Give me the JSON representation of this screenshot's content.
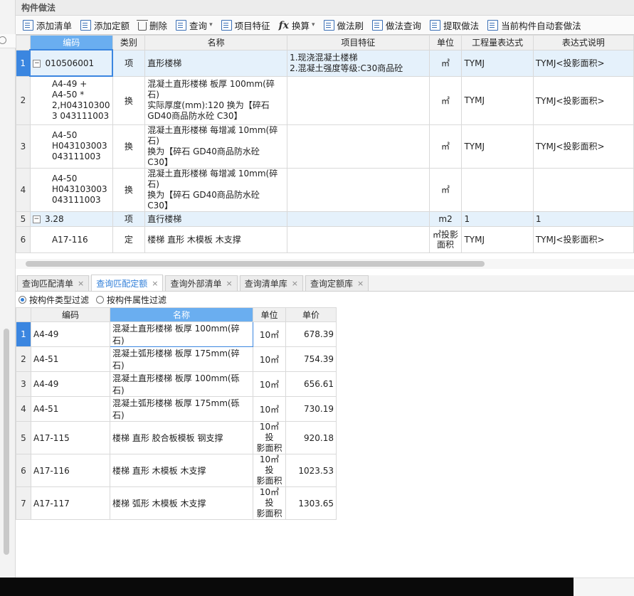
{
  "panel": {
    "title": "构件做法"
  },
  "toolbar": {
    "items": [
      {
        "label": "添加清单",
        "icon": "add-list-icon"
      },
      {
        "label": "添加定额",
        "icon": "add-quota-icon"
      },
      {
        "label": "删除",
        "icon": "trash-icon"
      },
      {
        "label": "查询",
        "icon": "query-icon",
        "dropdown": true
      },
      {
        "label": "项目特征",
        "icon": "feature-icon"
      },
      {
        "label": "换算",
        "icon": "fx-icon",
        "dropdown": true
      },
      {
        "label": "做法刷",
        "icon": "brush-icon"
      },
      {
        "label": "做法查询",
        "icon": "method-query-icon"
      },
      {
        "label": "提取做法",
        "icon": "extract-icon"
      },
      {
        "label": "当前构件自动套做法",
        "icon": "auto-apply-icon"
      }
    ]
  },
  "upper_table": {
    "headers": [
      "编码",
      "类别",
      "名称",
      "项目特征",
      "单位",
      "工程量表达式",
      "表达式说明"
    ],
    "rows": [
      {
        "num": "1",
        "code": "010506001",
        "category": "项",
        "name": "直形楼梯",
        "feature": "1.现浇混凝土楼梯\n2.混凝土强度等级:C30商品砼",
        "unit": "㎡",
        "expr": "TYMJ",
        "desc": "TYMJ<投影面积>"
      },
      {
        "num": "2",
        "code": "A4-49 +\nA4-50 *\n2,H04310300\n3 043111003",
        "category": "换",
        "name": "混凝土直形楼梯 板厚 100mm(碎石)\n 实际厚度(mm):120  换为【碎石\nGD40商品防水砼 C30】",
        "feature": "",
        "unit": "㎡",
        "expr": "TYMJ",
        "desc": "TYMJ<投影面积>"
      },
      {
        "num": "3",
        "code": "A4-50\nH043103003\n043111003",
        "category": "换",
        "name": "混凝土直形楼梯 每增减 10mm(碎石)\n 换为【碎石 GD40商品防水砼\nC30】",
        "feature": "",
        "unit": "㎡",
        "expr": "TYMJ",
        "desc": "TYMJ<投影面积>"
      },
      {
        "num": "4",
        "code": "A4-50\nH043103003\n043111003",
        "category": "换",
        "name": "混凝土直形楼梯 每增减 10mm(碎石)\n 换为【碎石 GD40商品防水砼\nC30】",
        "feature": "",
        "unit": "㎡",
        "expr": "",
        "desc": ""
      },
      {
        "num": "5",
        "code": "3.28",
        "category": "项",
        "name": "直行楼梯",
        "feature": "",
        "unit": "m2",
        "expr": "1",
        "desc": "1"
      },
      {
        "num": "6",
        "code": "A17-116",
        "category": "定",
        "name": "楼梯 直形 木模板 木支撑",
        "feature": "",
        "unit": "㎡投影\n面积",
        "expr": "TYMJ",
        "desc": "TYMJ<投影面积>"
      }
    ]
  },
  "tabs": [
    {
      "label": "查询匹配清单",
      "active": false
    },
    {
      "label": "查询匹配定额",
      "active": true
    },
    {
      "label": "查询外部清单",
      "active": false
    },
    {
      "label": "查询清单库",
      "active": false
    },
    {
      "label": "查询定额库",
      "active": false
    }
  ],
  "filter": {
    "option1": "按构件类型过滤",
    "option2": "按构件属性过滤",
    "selected": "option1"
  },
  "lower_table": {
    "headers": [
      "编码",
      "名称",
      "单位",
      "单价"
    ],
    "rows": [
      {
        "num": "1",
        "code": "A4-49",
        "name": "混凝土直形楼梯 板厚 100mm(碎石)",
        "unit": "10㎡",
        "price": "678.39"
      },
      {
        "num": "2",
        "code": "A4-51",
        "name": "混凝土弧形楼梯 板厚 175mm(碎石)",
        "unit": "10㎡",
        "price": "754.39"
      },
      {
        "num": "3",
        "code": "A4-49",
        "name": "混凝土直形楼梯 板厚 100mm(砾石)",
        "unit": "10㎡",
        "price": "656.61"
      },
      {
        "num": "4",
        "code": "A4-51",
        "name": "混凝土弧形楼梯 板厚 175mm(砾石)",
        "unit": "10㎡",
        "price": "730.19"
      },
      {
        "num": "5",
        "code": "A17-115",
        "name": "楼梯 直形 胶合板模板 钢支撑",
        "unit": "10㎡投\n影面积",
        "price": "920.18"
      },
      {
        "num": "6",
        "code": "A17-116",
        "name": "楼梯 直形 木模板 木支撑",
        "unit": "10㎡投\n影面积",
        "price": "1023.53"
      },
      {
        "num": "7",
        "code": "A17-117",
        "name": "楼梯 弧形 木模板 木支撑",
        "unit": "10㎡投\n影面积",
        "price": "1303.65"
      }
    ]
  },
  "colors": {
    "accent": "#2f7ed8",
    "selected_header": "#6aaef0",
    "row_highlight": "#e5f1fb",
    "active_row_number": "#3b86e0"
  }
}
